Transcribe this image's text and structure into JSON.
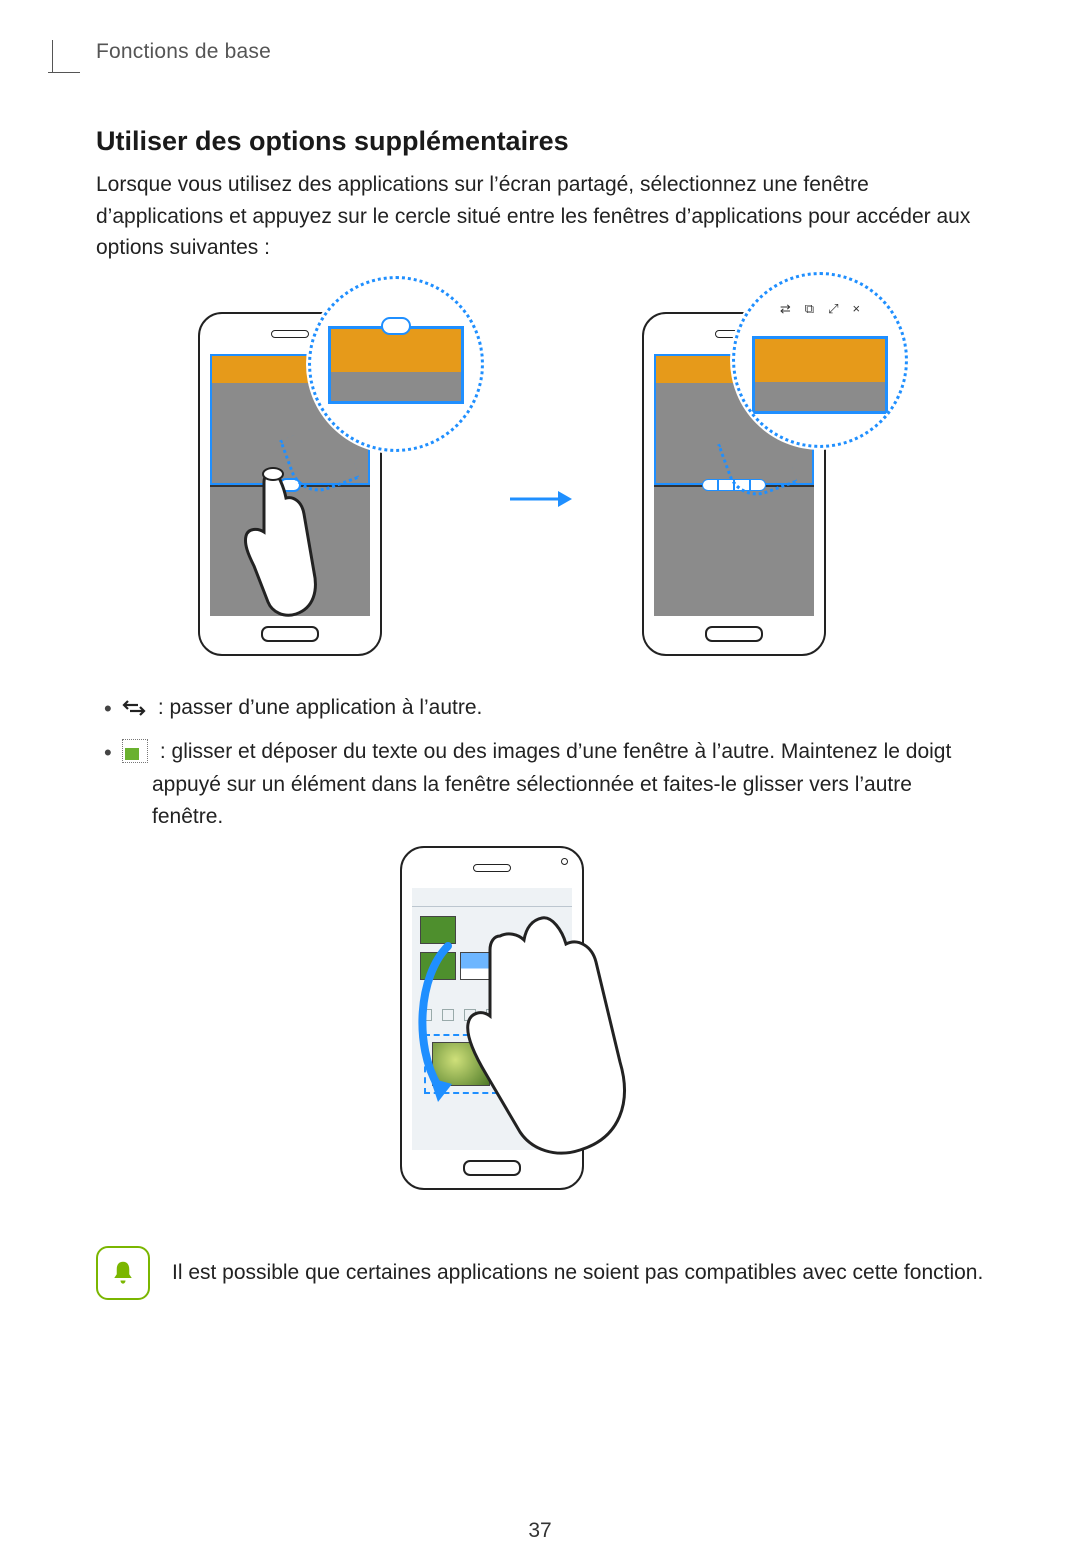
{
  "running_header": "Fonctions de base",
  "section": {
    "title": "Utiliser des options supplémentaires",
    "lead": "Lorsque vous utilisez des applications sur l’écran partagé, sélectionnez une fenêtre d’applications et appuyez sur le cercle situé entre les fenêtres d’applications pour accéder aux options suivantes :"
  },
  "zoom_icons": [
    "⇄",
    "⧉",
    "⤢",
    "×"
  ],
  "options": [
    {
      "icon": "swap",
      "text": ": passer d’une application à l’autre."
    },
    {
      "icon": "dragdrop",
      "text": ": glisser et déposer du texte ou des images d’une fenêtre à l’autre. Maintenez le doigt appuyé sur un élément dans la fenêtre sélectionnée et faites-le glisser vers l’autre fenêtre."
    }
  ],
  "note": {
    "text": "Il est possible que certaines applications ne soient pas compatibles avec cette fonction."
  },
  "page_number": "37"
}
